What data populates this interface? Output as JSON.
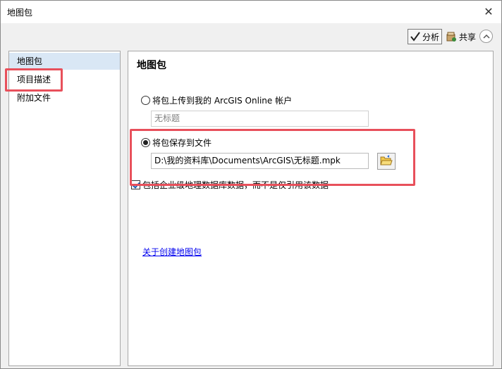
{
  "window": {
    "title": "地图包",
    "close_symbol": "✕"
  },
  "toolbar": {
    "analyze_label": "分析",
    "share_label": "共享"
  },
  "sidebar": {
    "items": [
      {
        "label": "地图包",
        "selected": true
      },
      {
        "label": "项目描述",
        "selected": false
      },
      {
        "label": "附加文件",
        "selected": false
      }
    ]
  },
  "main": {
    "section_title": "地图包",
    "upload_option_label": "将包上传到我的 ArcGIS Online 帐户",
    "upload_title_placeholder": "无标题",
    "save_option_label": "将包保存到文件",
    "save_path_value": "D:\\我的资料库\\Documents\\ArcGIS\\无标题.mpk",
    "include_enterprise_label": "包括企业级地理数据库数据，而不是仅引用该数据",
    "about_link": "关于创建地图包"
  },
  "colors": {
    "highlight": "#e8505b",
    "selected_nav": "#d9e7f5",
    "link": "#0000ee"
  },
  "icons": {
    "analyze": "check-icon",
    "share": "share-icon",
    "collapse": "chevron-up-icon",
    "browse": "folder-open-icon",
    "close": "close-icon"
  }
}
